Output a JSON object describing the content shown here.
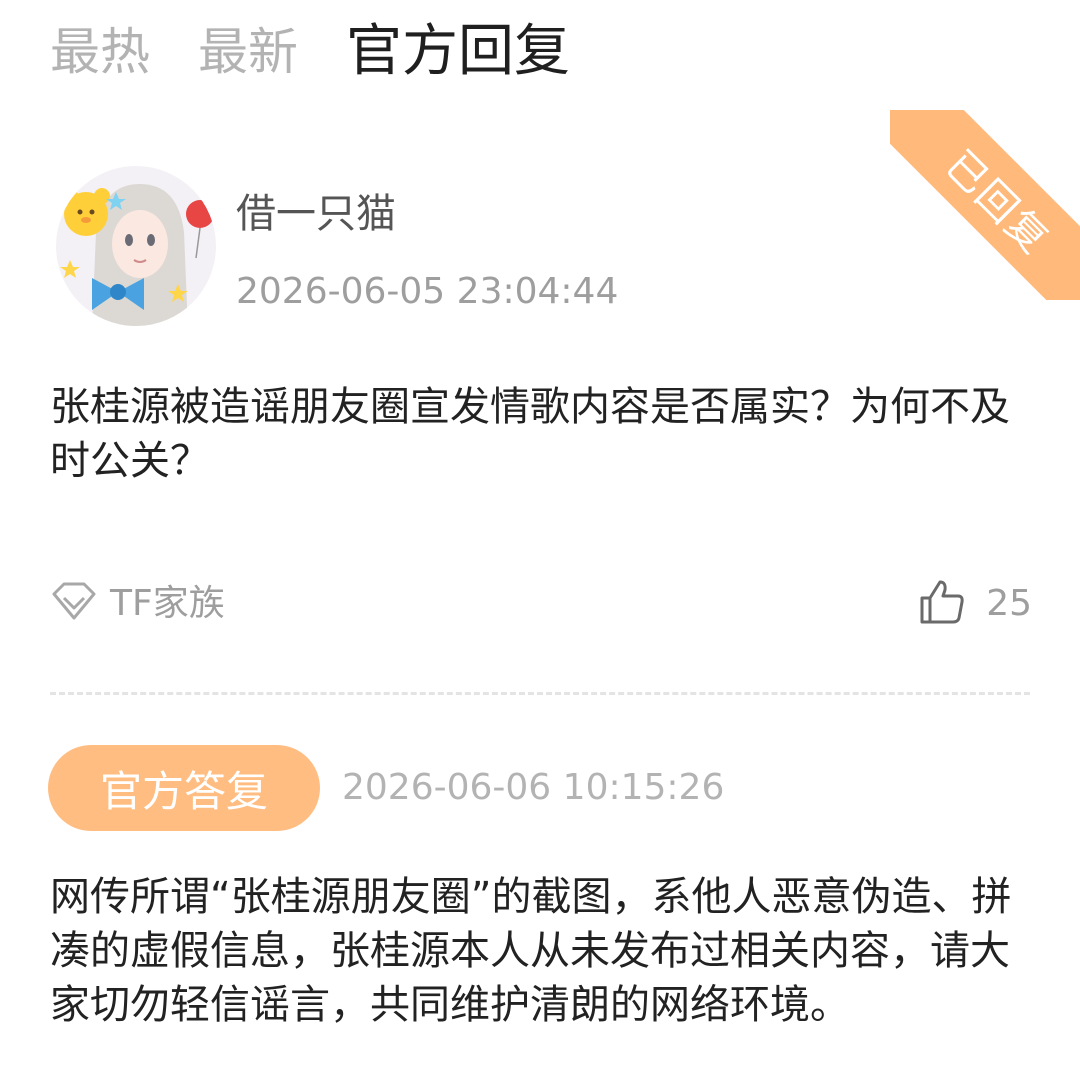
{
  "tabs": [
    {
      "label": "最热"
    },
    {
      "label": "最新"
    },
    {
      "label": "官方回复"
    }
  ],
  "status_ribbon": "已回复",
  "post": {
    "username": "借一只猫",
    "timestamp": "2026-06-05 23:04:44",
    "question": "张桂源被造谣朋友圈宣发情歌内容是否属实？为何不及时公关？",
    "tag": "TF家族",
    "likes": "25"
  },
  "reply": {
    "badge": "官方答复",
    "timestamp": "2026-06-06 10:15:26",
    "text": "网传所谓“张桂源朋友圈”的截图，系他人恶意伪造、拼凑的虚假信息，张桂源本人从未发布过相关内容，请大家切勿轻信谣言，共同维护清朗的网络环境。"
  },
  "colors": {
    "accent": "#ffbd82",
    "ribbon": "#ffb97a",
    "text": "#222222",
    "muted": "#9e9e9e",
    "tab_inactive": "#b3b3b3"
  }
}
